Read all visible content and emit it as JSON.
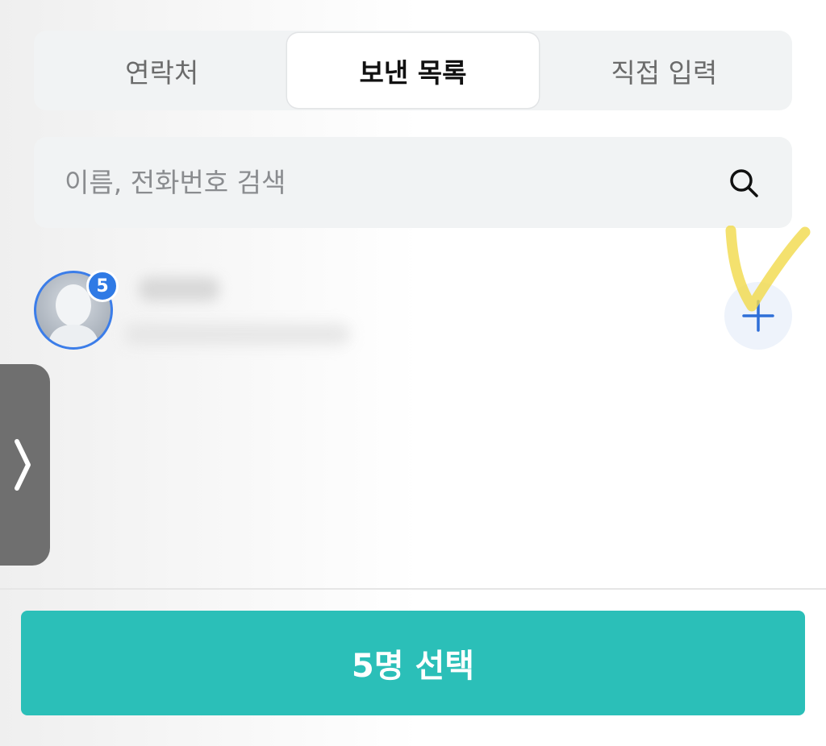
{
  "tabs": [
    {
      "label": "연락처"
    },
    {
      "label": "보낸 목록"
    },
    {
      "label": "직접 입력"
    }
  ],
  "active_tab": 1,
  "search": {
    "placeholder": "이름, 전화번호 검색",
    "value": ""
  },
  "contact": {
    "badge_count": "5"
  },
  "confirm_button": {
    "label": "5명 선택"
  },
  "colors": {
    "accent": "#2bbfb8",
    "badge": "#2f7ae5",
    "add_icon": "#2f6fd8",
    "highlight": "#f1d94a"
  }
}
